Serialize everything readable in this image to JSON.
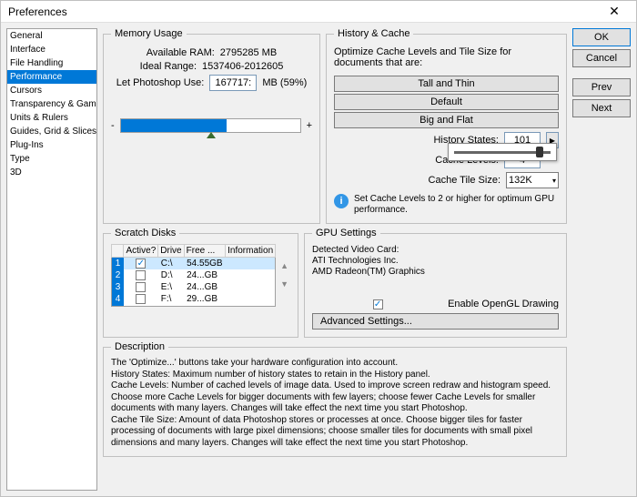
{
  "window": {
    "title": "Preferences"
  },
  "sidebar": {
    "items": [
      {
        "label": "General"
      },
      {
        "label": "Interface"
      },
      {
        "label": "File Handling"
      },
      {
        "label": "Performance",
        "selected": true
      },
      {
        "label": "Cursors"
      },
      {
        "label": "Transparency & Gamut"
      },
      {
        "label": "Units & Rulers"
      },
      {
        "label": "Guides, Grid & Slices"
      },
      {
        "label": "Plug-Ins"
      },
      {
        "label": "Type"
      },
      {
        "label": "3D"
      }
    ]
  },
  "buttons": {
    "ok": "OK",
    "cancel": "Cancel",
    "prev": "Prev",
    "next": "Next"
  },
  "memory": {
    "legend": "Memory Usage",
    "available_label": "Available RAM:",
    "available_value": "2795285 MB",
    "ideal_label": "Ideal Range:",
    "ideal_value": "1537406-2012605",
    "let_label": "Let Photoshop Use:",
    "let_value": "167717:",
    "let_suffix": "MB (59%)",
    "minus": "-",
    "plus": "+"
  },
  "history": {
    "legend": "History & Cache",
    "intro": "Optimize Cache Levels and Tile Size for documents that are:",
    "btn_tall": "Tall and Thin",
    "btn_default": "Default",
    "btn_big": "Big and Flat",
    "states_label": "History States:",
    "states_value": "101",
    "levels_label": "Cache Levels:",
    "levels_value": "4",
    "tile_label": "Cache Tile Size:",
    "tile_value": "132K",
    "info": "Set Cache Levels to 2 or higher for optimum GPU performance."
  },
  "scratch": {
    "legend": "Scratch Disks",
    "headers": {
      "active": "Active?",
      "drive": "Drive",
      "free": "Free ...",
      "info": "Information"
    },
    "rows": [
      {
        "num": "1",
        "active": true,
        "drive": "C:\\",
        "free": "54.55GB",
        "info": ""
      },
      {
        "num": "2",
        "active": false,
        "drive": "D:\\",
        "free": "24...GB",
        "info": ""
      },
      {
        "num": "3",
        "active": false,
        "drive": "E:\\",
        "free": "24...GB",
        "info": ""
      },
      {
        "num": "4",
        "active": false,
        "drive": "F:\\",
        "free": "29...GB",
        "info": ""
      }
    ]
  },
  "gpu": {
    "legend": "GPU Settings",
    "detected_label": "Detected Video Card:",
    "card_vendor": "ATI Technologies Inc.",
    "card_name": "AMD Radeon(TM) Graphics",
    "enable_label": "Enable OpenGL Drawing",
    "advanced_btn": "Advanced Settings..."
  },
  "description": {
    "legend": "Description",
    "text": "The 'Optimize...' buttons take your hardware configuration into account.\nHistory States: Maximum number of history states to retain in the History panel.\nCache Levels: Number of cached levels of image data.  Used to improve screen redraw and histogram speed.  Choose more Cache Levels for bigger documents with few layers; choose fewer Cache Levels for smaller documents with many layers. Changes will take effect the next time you start Photoshop.\nCache Tile Size: Amount of data Photoshop stores or processes at once. Choose bigger tiles for faster processing of documents with large pixel dimensions; choose smaller tiles for documents with small pixel dimensions and many layers. Changes will take effect the next time you start Photoshop."
  }
}
